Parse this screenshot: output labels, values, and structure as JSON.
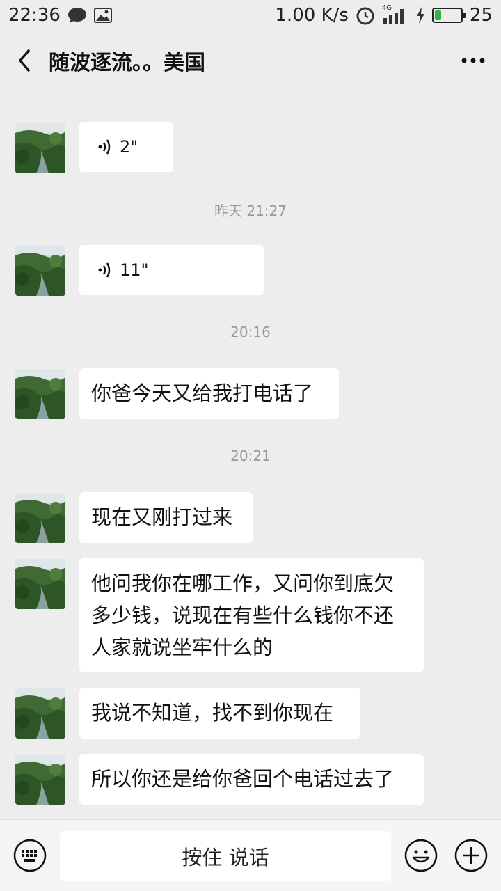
{
  "status_bar": {
    "time": "22:36",
    "net_speed": "1.00 K/s",
    "signal": "4G",
    "battery": "25",
    "battery_level": 0.25,
    "icons": [
      "chat-bubble-icon",
      "image-icon",
      "alarm-icon",
      "signal-icon",
      "charging-icon",
      "battery-icon"
    ]
  },
  "header": {
    "title": "随波逐流。。美国",
    "back_icon": "chevron-left-icon",
    "more_icon": "more-dots-icon"
  },
  "messages": [
    {
      "type": "voice",
      "duration": "2\""
    },
    {
      "type": "timestamp",
      "text": "昨天 21:27"
    },
    {
      "type": "voice",
      "duration": "11\""
    },
    {
      "type": "timestamp",
      "text": "20:16"
    },
    {
      "type": "text",
      "text": "你爸今天又给我打电话了"
    },
    {
      "type": "timestamp",
      "text": "20:21"
    },
    {
      "type": "text",
      "text": "现在又刚打过来"
    },
    {
      "type": "text",
      "lines": [
        "他问我你在哪工作，又问你到底欠",
        "多少钱，说现在有些什么钱你不还",
        "人家就说坐牢什么的"
      ]
    },
    {
      "type": "text",
      "text": "我说不知道，找不到你现在"
    },
    {
      "type": "text",
      "text": "所以你还是给你爸回个电话过去了"
    }
  ],
  "input_bar": {
    "hold_to_talk": "按住 说话",
    "icons": [
      "keyboard-icon",
      "emoji-icon",
      "plus-icon"
    ]
  },
  "colors": {
    "background": "#ededed",
    "bubble": "#ffffff",
    "timestamp": "#999999",
    "battery_fill": "#2db33f"
  }
}
